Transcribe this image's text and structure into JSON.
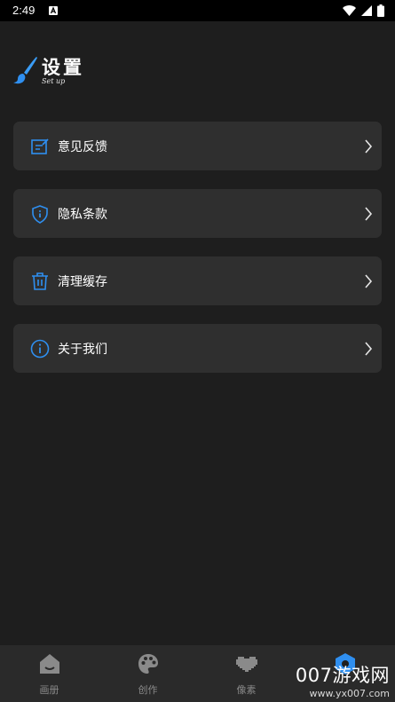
{
  "status_bar": {
    "time": "2:49"
  },
  "header": {
    "title": "设置",
    "subtitle": "Set up"
  },
  "menu": [
    {
      "label": "意见反馈",
      "icon": "feedback-edit-icon"
    },
    {
      "label": "隐私条款",
      "icon": "privacy-shield-icon"
    },
    {
      "label": "清理缓存",
      "icon": "trash-icon"
    },
    {
      "label": "关于我们",
      "icon": "info-circle-icon"
    }
  ],
  "tabs": [
    {
      "label": "画册",
      "icon": "home-icon"
    },
    {
      "label": "创作",
      "icon": "palette-icon"
    },
    {
      "label": "像素",
      "icon": "pixel-heart-icon"
    },
    {
      "label": "设置",
      "icon": "settings-hexagon-icon"
    }
  ],
  "watermark": {
    "top": "007游戏网",
    "bottom": "www.yx007.com"
  },
  "colors": {
    "accent": "#2f8ff0",
    "card": "#2f2f2f",
    "background": "#1e1e1e",
    "tabbar": "#2a2a2a"
  }
}
